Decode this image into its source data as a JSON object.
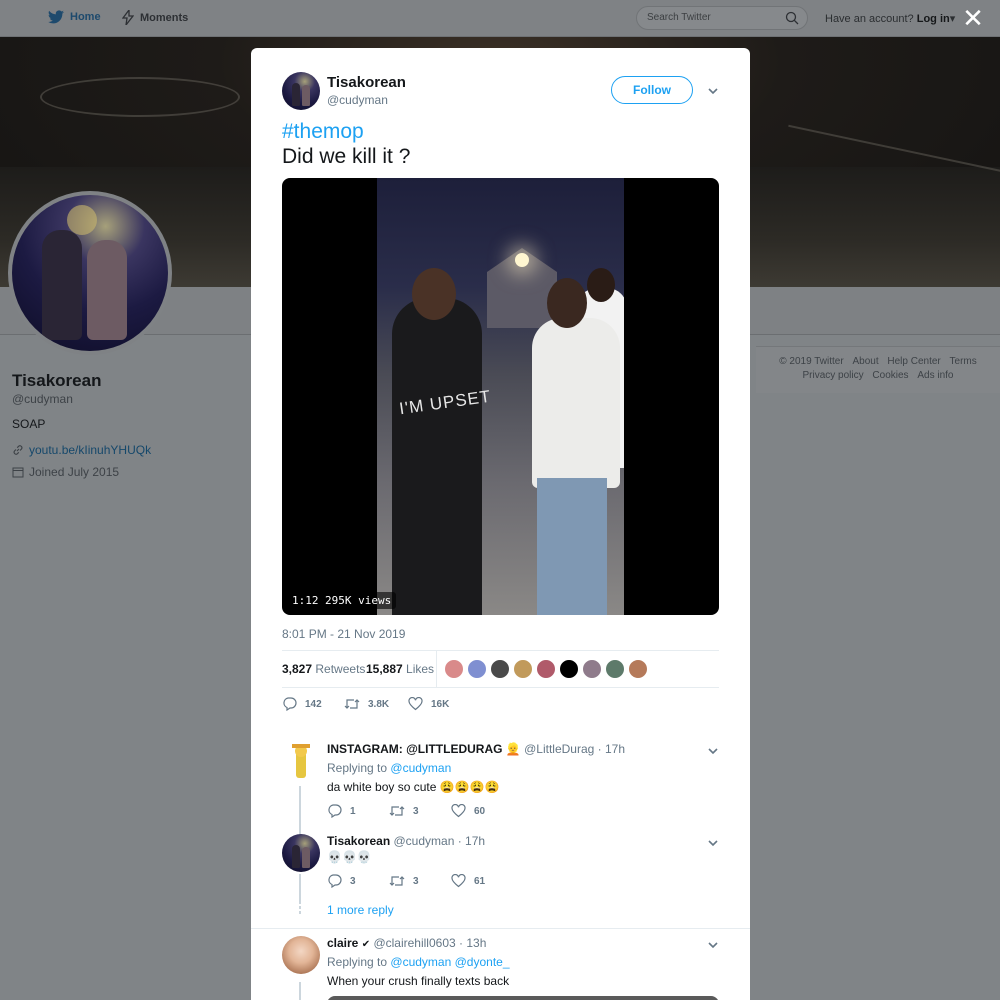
{
  "nav": {
    "home_label": "Home",
    "moments_label": "Moments",
    "search_placeholder": "Search Twitter",
    "account_prompt": "Have an account?",
    "login_label": "Log in"
  },
  "profile": {
    "name": "Tisakorean",
    "handle": "@cudyman",
    "bio": "SOAP",
    "link": "youtu.be/kIinuhYHUQk",
    "joined": "Joined July 2015"
  },
  "footer": {
    "links_row1": [
      "© 2019 Twitter",
      "About",
      "Help Center",
      "Terms"
    ],
    "links_row2": [
      "Privacy policy",
      "Cookies",
      "Ads info"
    ]
  },
  "tweet": {
    "author_name": "Tisakorean",
    "author_handle": "@cudyman",
    "follow_label": "Follow",
    "hashtag": "#themop",
    "text": "Did we kill it ?",
    "video_duration": "1:12",
    "video_views": "295K views",
    "video_shirt_text": "I'M UPSET",
    "timestamp": "8:01 PM - 21 Nov 2019",
    "retweets_count": "3,827",
    "retweets_label": "Retweets",
    "likes_count": "15,887",
    "likes_label": "Likes",
    "liker_colors": [
      "#d98a8a",
      "#7f8fd1",
      "#4a4a4a",
      "#c19a5b",
      "#b05a6a",
      "#000000",
      "#8f7b8b",
      "#5d7a6a",
      "#b57a5a"
    ],
    "actions": {
      "replies": "142",
      "retweets": "3.8K",
      "likes": "16K"
    }
  },
  "replies": [
    {
      "name": "INSTAGRAM: @LITTLEDURAG",
      "emoji": "👱",
      "handle": "@LittleDurag",
      "time": "· 17h",
      "replying_prefix": "Replying to",
      "replying_to": [
        "@cudyman"
      ],
      "text": "da white boy so cute 😩😩😩😩",
      "counts": {
        "replies": "1",
        "retweets": "3",
        "likes": "60"
      }
    },
    {
      "name": "Tisakorean",
      "handle": "@cudyman",
      "time": "· 17h",
      "text": "💀💀💀",
      "counts": {
        "replies": "3",
        "retweets": "3",
        "likes": "61"
      }
    },
    {
      "name": "claire",
      "verified_mark": "✔",
      "handle": "@clairehill0603",
      "time": "· 13h",
      "replying_prefix": "Replying to",
      "replying_to": [
        "@cudyman",
        "@dyonte_"
      ],
      "text": "When your crush finally texts back"
    }
  ],
  "more_replies_label": "1 more reply",
  "colors": {
    "accent": "#1da1f2",
    "text": "#14171a",
    "muted": "#657786"
  },
  "icons": [
    "twitter-bird-icon",
    "moments-bolt-icon",
    "search-icon",
    "close-icon",
    "chevron-down-icon",
    "link-icon",
    "calendar-icon",
    "reply-icon",
    "retweet-icon",
    "like-icon",
    "verified-icon"
  ]
}
